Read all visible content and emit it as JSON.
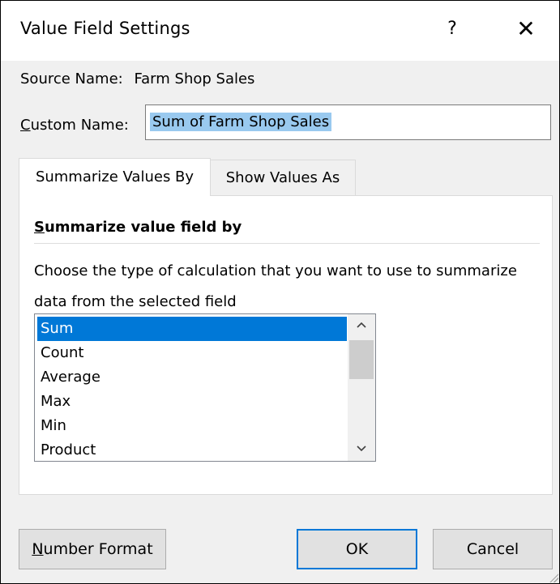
{
  "dialog": {
    "title": "Value Field Settings",
    "help_label": "?",
    "close_label": "✕"
  },
  "source": {
    "label": "Source Name:",
    "value": "Farm Shop Sales"
  },
  "custom_name": {
    "label_access_key": "C",
    "label_rest": "ustom Name:",
    "value": "Sum of Farm Shop Sales"
  },
  "tabs": [
    {
      "label": "Summarize Values By",
      "active": true
    },
    {
      "label": "Show Values As",
      "active": false
    }
  ],
  "panel": {
    "section_title_access_key": "S",
    "section_title_rest": "ummarize value field by",
    "description": "Choose the type of calculation that you want to use to summarize data from the selected field",
    "selected_item": "Sum",
    "items": [
      "Sum",
      "Count",
      "Average",
      "Max",
      "Min",
      "Product"
    ]
  },
  "buttons": {
    "number_format_access_key": "N",
    "number_format_rest": "umber Format",
    "ok": "OK",
    "cancel": "Cancel"
  },
  "colors": {
    "selection": "#0078d7",
    "text_highlight": "#99c9ef"
  }
}
